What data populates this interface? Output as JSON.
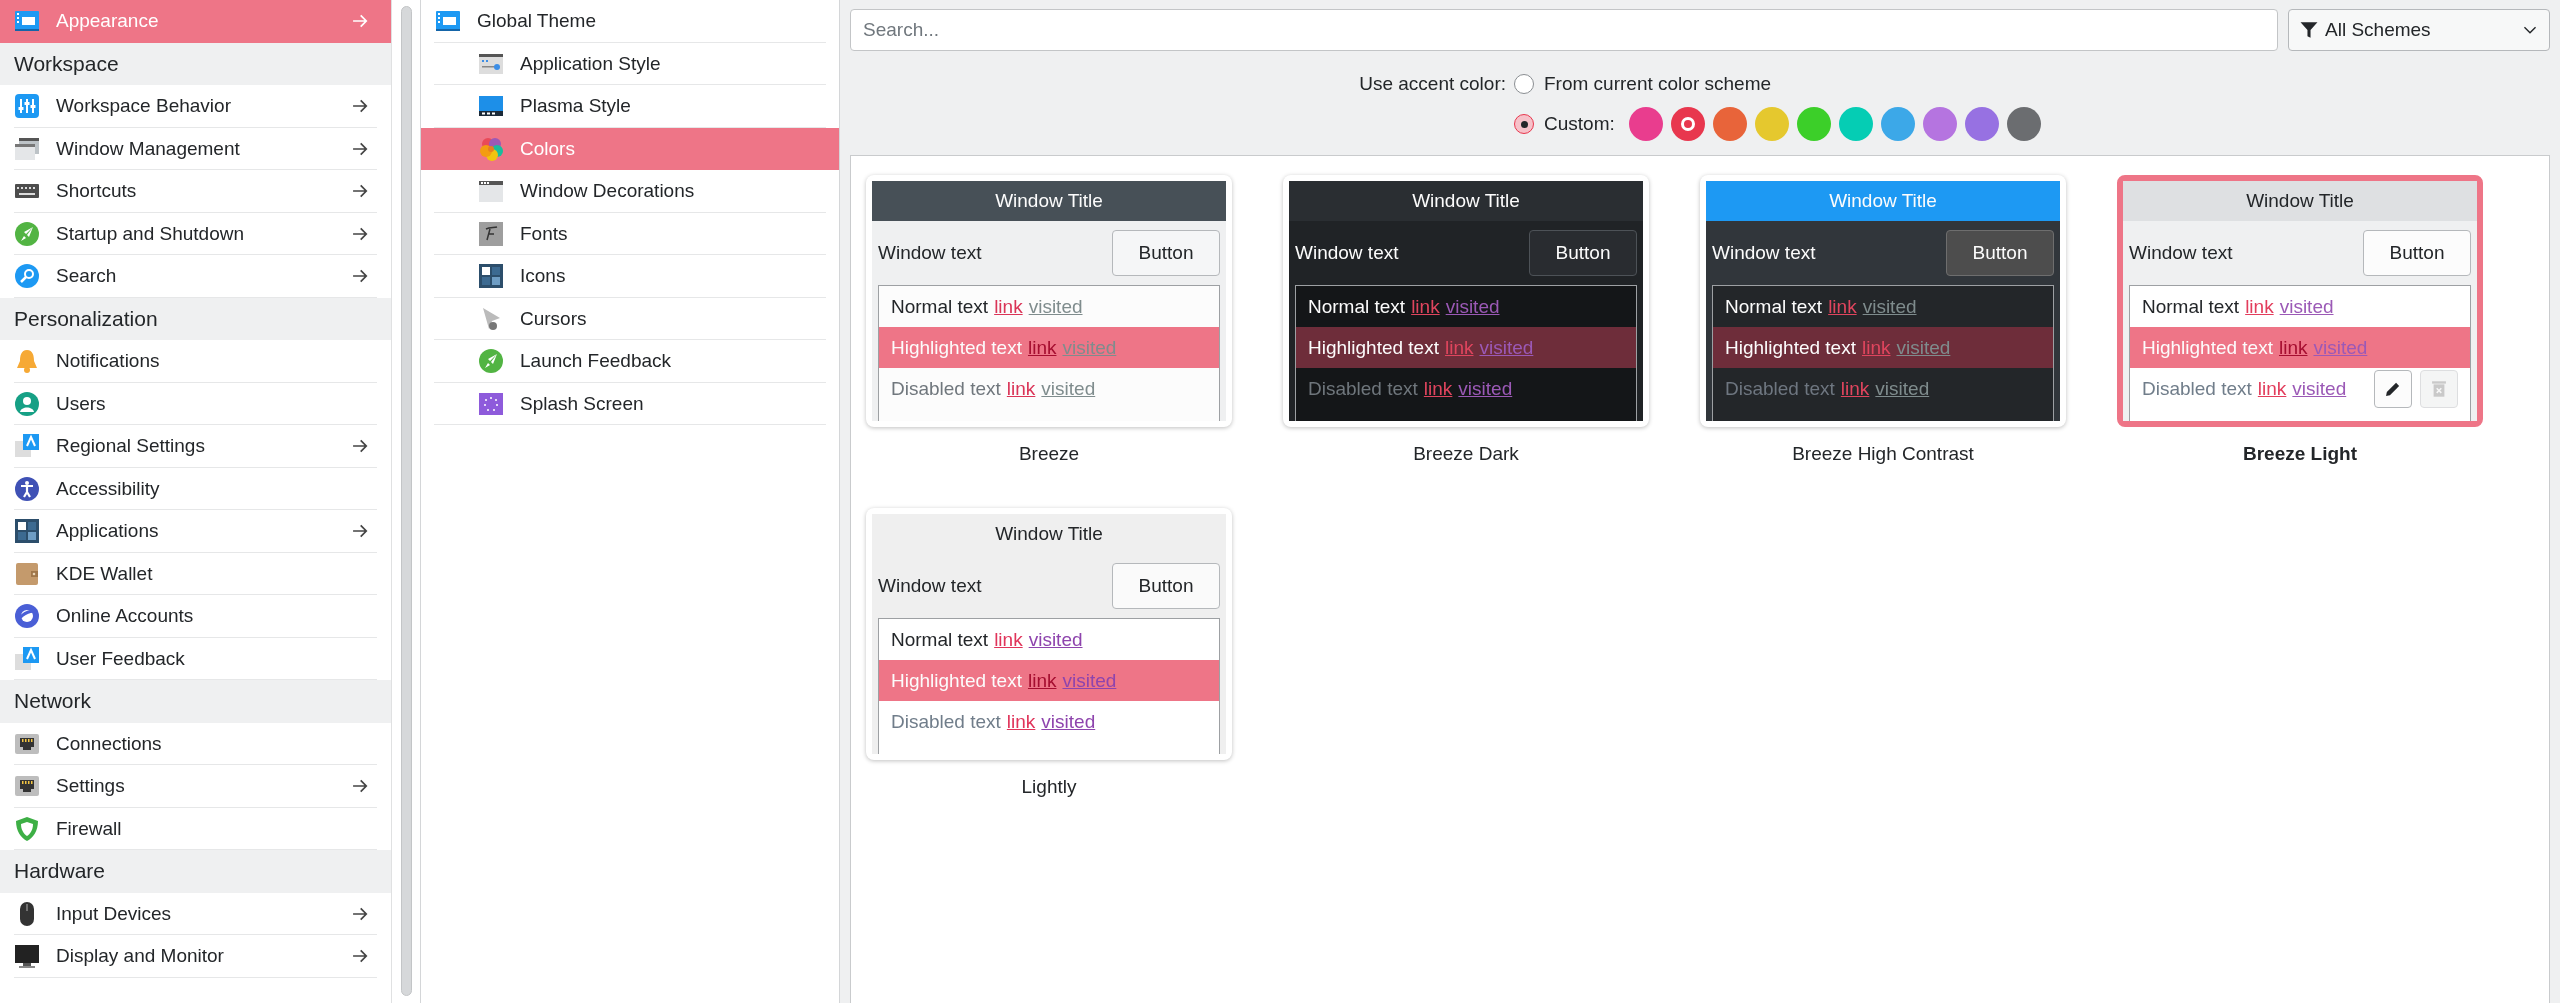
{
  "sidebar": {
    "items": [
      {
        "kind": "item",
        "label": "Appearance",
        "arrow": true,
        "selected": true
      },
      {
        "kind": "header",
        "label": "Workspace"
      },
      {
        "kind": "item",
        "label": "Workspace Behavior",
        "arrow": true,
        "selected": false
      },
      {
        "kind": "item",
        "label": "Window Management",
        "arrow": true,
        "selected": false
      },
      {
        "kind": "item",
        "label": "Shortcuts",
        "arrow": true,
        "selected": false
      },
      {
        "kind": "item",
        "label": "Startup and Shutdown",
        "arrow": true,
        "selected": false
      },
      {
        "kind": "item",
        "label": "Search",
        "arrow": true,
        "selected": false
      },
      {
        "kind": "header",
        "label": "Personalization"
      },
      {
        "kind": "item",
        "label": "Notifications",
        "arrow": false,
        "selected": false
      },
      {
        "kind": "item",
        "label": "Users",
        "arrow": false,
        "selected": false
      },
      {
        "kind": "item",
        "label": "Regional Settings",
        "arrow": true,
        "selected": false
      },
      {
        "kind": "item",
        "label": "Accessibility",
        "arrow": false,
        "selected": false
      },
      {
        "kind": "item",
        "label": "Applications",
        "arrow": true,
        "selected": false
      },
      {
        "kind": "item",
        "label": "KDE Wallet",
        "arrow": false,
        "selected": false
      },
      {
        "kind": "item",
        "label": "Online Accounts",
        "arrow": false,
        "selected": false
      },
      {
        "kind": "item",
        "label": "User Feedback",
        "arrow": false,
        "selected": false
      },
      {
        "kind": "header",
        "label": "Network"
      },
      {
        "kind": "item",
        "label": "Connections",
        "arrow": false,
        "selected": false
      },
      {
        "kind": "item",
        "label": "Settings",
        "arrow": true,
        "selected": false
      },
      {
        "kind": "item",
        "label": "Firewall",
        "arrow": false,
        "selected": false
      },
      {
        "kind": "header",
        "label": "Hardware"
      },
      {
        "kind": "item",
        "label": "Input Devices",
        "arrow": true,
        "selected": false
      },
      {
        "kind": "item",
        "label": "Display and Monitor",
        "arrow": true,
        "selected": false
      }
    ]
  },
  "subpages": {
    "label": "Global Theme",
    "selected": false,
    "children": [
      {
        "label": "Application Style",
        "selected": false
      },
      {
        "label": "Plasma Style",
        "selected": false
      },
      {
        "label": "Colors",
        "selected": true
      },
      {
        "label": "Window Decorations",
        "selected": false
      },
      {
        "label": "Fonts",
        "selected": false
      },
      {
        "label": "Icons",
        "selected": false
      },
      {
        "label": "Cursors",
        "selected": false
      },
      {
        "label": "Launch Feedback",
        "selected": false
      },
      {
        "label": "Splash Screen",
        "selected": false
      }
    ]
  },
  "toolbar": {
    "search": {
      "placeholder": "Search..."
    },
    "filter": {
      "value": "All Schemes"
    }
  },
  "accent": {
    "label": "Use accent color:",
    "options": [
      {
        "label": "From current color scheme",
        "selected": false
      },
      {
        "label": "Custom:",
        "selected": true
      }
    ],
    "swatches": [
      {
        "color": "#e93d8e",
        "selected": false
      },
      {
        "color": "#e8374e",
        "selected": true
      },
      {
        "color": "#e8643a",
        "selected": false
      },
      {
        "color": "#e5c82e",
        "selected": false
      },
      {
        "color": "#3ccf29",
        "selected": false
      },
      {
        "color": "#05cdb4",
        "selected": false
      },
      {
        "color": "#3ca8e8",
        "selected": false
      },
      {
        "color": "#b574e0",
        "selected": false
      },
      {
        "color": "#9771e2",
        "selected": false
      },
      {
        "color": "#6b6d70",
        "selected": false
      }
    ]
  },
  "schemes": [
    {
      "name": "Breeze",
      "selected": false,
      "preview": {
        "title": "Window Title",
        "window_text": "Window text",
        "button": "Button",
        "rows": [
          {
            "kind": "normal",
            "text": "Normal text",
            "link": "link",
            "visited": "visited"
          },
          {
            "kind": "highlighted",
            "text": "Highlighted text",
            "link": "link",
            "visited": "visited"
          },
          {
            "kind": "disabled",
            "text": "Disabled text",
            "link": "link",
            "visited": "visited"
          }
        ]
      }
    },
    {
      "name": "Breeze Dark",
      "selected": false,
      "preview": {
        "title": "Window Title",
        "window_text": "Window text",
        "button": "Button",
        "rows": [
          {
            "kind": "normal",
            "text": "Normal text",
            "link": "link",
            "visited": "visited"
          },
          {
            "kind": "highlighted",
            "text": "Highlighted text",
            "link": "link",
            "visited": "visited"
          },
          {
            "kind": "disabled",
            "text": "Disabled text",
            "link": "link",
            "visited": "visited"
          }
        ]
      }
    },
    {
      "name": "Breeze High Contrast",
      "selected": false,
      "preview": {
        "title": "Window Title",
        "window_text": "Window text",
        "button": "Button",
        "rows": [
          {
            "kind": "normal",
            "text": "Normal text",
            "link": "link",
            "visited": "visited"
          },
          {
            "kind": "highlighted",
            "text": "Highlighted text",
            "link": "link",
            "visited": "visited"
          },
          {
            "kind": "disabled",
            "text": "Disabled text",
            "link": "link",
            "visited": "visited"
          }
        ]
      }
    },
    {
      "name": "Breeze Light",
      "selected": true,
      "preview": {
        "title": "Window Title",
        "window_text": "Window text",
        "button": "Button",
        "rows": [
          {
            "kind": "normal",
            "text": "Normal text",
            "link": "link",
            "visited": "visited"
          },
          {
            "kind": "highlighted",
            "text": "Highlighted text",
            "link": "link",
            "visited": "visited"
          },
          {
            "kind": "disabled",
            "text": "Disabled text",
            "link": "link",
            "visited": "visited"
          }
        ]
      }
    },
    {
      "name": "Lightly",
      "selected": false,
      "preview": {
        "title": "Window Title",
        "window_text": "Window text",
        "button": "Button",
        "rows": [
          {
            "kind": "normal",
            "text": "Normal text",
            "link": "link",
            "visited": "visited"
          },
          {
            "kind": "highlighted",
            "text": "Highlighted text",
            "link": "link",
            "visited": "visited"
          },
          {
            "kind": "disabled",
            "text": "Disabled text",
            "link": "link",
            "visited": "visited"
          }
        ]
      }
    }
  ]
}
